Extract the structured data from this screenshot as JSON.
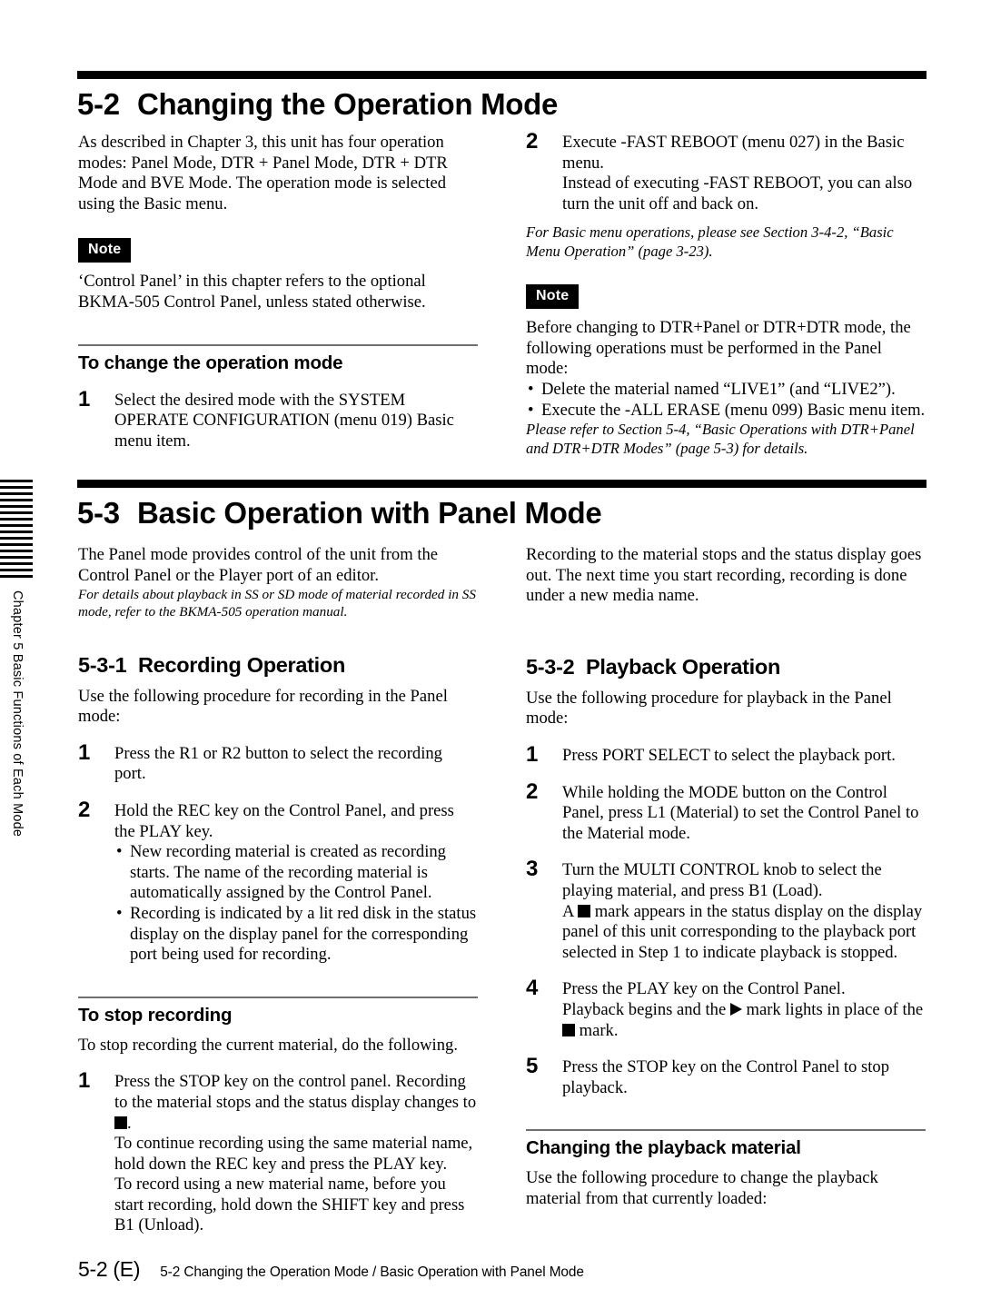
{
  "chapter_tab": {
    "label": "Chapter 5    Basic Functions of Each Mode"
  },
  "sections": {
    "s52": {
      "number": "5-2",
      "title": "Changing the Operation Mode",
      "left": {
        "intro": "As described in Chapter 3, this unit has four operation modes: Panel Mode, DTR + Panel Mode, DTR + DTR Mode and BVE Mode. The operation mode is selected using the Basic menu.",
        "note_label": "Note",
        "note_text": "‘Control Panel’ in this chapter refers to the optional BKMA-505 Control Panel, unless stated otherwise.",
        "subhead": "To change the operation mode",
        "step1_num": "1",
        "step1_text": "Select the desired mode with the SYSTEM OPERATE CONFIGURATION (menu 019) Basic menu item."
      },
      "right": {
        "step2_num": "2",
        "step2_line1": "Execute -FAST REBOOT (menu 027) in the Basic menu.",
        "step2_line2": "Instead of executing -FAST REBOOT, you can also turn the unit off and back on.",
        "ref1": "For Basic menu operations, please see Section 3-4-2, “Basic Menu Operation” (page 3-23).",
        "note_label": "Note",
        "note_text": "Before changing to DTR+Panel or DTR+DTR mode, the following operations must be performed in the Panel mode:",
        "note_bullets": [
          "Delete the material named “LIVE1” (and “LIVE2”).",
          "Execute the -ALL ERASE (menu 099) Basic menu item."
        ],
        "ref2": "Please refer to Section 5-4, “Basic Operations with DTR+Panel and DTR+DTR Modes” (page 5-3) for details."
      }
    },
    "s53": {
      "number": "5-3",
      "title": "Basic Operation with Panel Mode",
      "left": {
        "intro": "The Panel mode provides control of the unit from the Control Panel or the Player port of an editor.",
        "intro_ref": "For details about playback in SS or SD mode of material recorded in SS mode, refer to the BKMA-505 operation manual.",
        "sub531_num": "5-3-1",
        "sub531_title": "Recording Operation",
        "sub531_intro": "Use the following procedure for recording in the Panel mode:",
        "step1_num": "1",
        "step1_text": "Press the R1 or R2 button to select the recording port.",
        "step2_num": "2",
        "step2_text": "Hold the REC key on the Control Panel, and press the PLAY key.",
        "step2_bullets": [
          "New recording material is created as recording starts. The name of the recording material is automatically assigned by the Control Panel.",
          "Recording is indicated by a lit red disk in the status display on the display panel for the corresponding port being used for recording."
        ],
        "stop_subhead": "To stop recording",
        "stop_intro": "To stop recording the current material, do the following.",
        "stop_step_num": "1",
        "stop_step_part1": "Press the STOP key on the control panel. Recording to the material stops and the status display changes to ",
        "stop_step_part1_end": ".",
        "stop_step_part2": "To continue recording using the same material name, hold down the REC key and press the PLAY key.",
        "stop_step_part3": "To record using a new material name, before you start recording, hold down the SHIFT key and press B1 (Unload)."
      },
      "right": {
        "intro": "Recording to the material stops and the status display goes out. The next time you start recording, recording is done under a new media name.",
        "sub532_num": "5-3-2",
        "sub532_title": "Playback Operation",
        "sub532_intro": "Use the following procedure for playback in the Panel mode:",
        "step1_num": "1",
        "step1_text": "Press PORT SELECT to select the playback port.",
        "step2_num": "2",
        "step2_text": "While holding the MODE button on the Control Panel, press L1 (Material) to set the Control Panel to the Material mode.",
        "step3_num": "3",
        "step3_line1": "Turn the MULTI CONTROL knob to select the playing material, and press B1 (Load).",
        "step3_line2_pre": "A ",
        "step3_line2_post": " mark appears in the status display on the display panel of this unit corresponding to the playback port selected in Step 1 to indicate playback is stopped.",
        "step4_num": "4",
        "step4_line1": "Press the PLAY key on the Control Panel.",
        "step4_line2_pre": "Playback begins and the ",
        "step4_line2_mid": " mark lights in place of the ",
        "step4_line2_post": " mark.",
        "step5_num": "5",
        "step5_text": "Press the STOP key on the Control Panel to stop playback.",
        "change_subhead": "Changing the playback material",
        "change_intro": "Use the following procedure to change the playback material from that currently loaded:"
      }
    }
  },
  "footer": {
    "page_number": "5-2 (E)",
    "breadcrumb": "5-2 Changing the Operation Mode /  Basic Operation with Panel Mode"
  }
}
